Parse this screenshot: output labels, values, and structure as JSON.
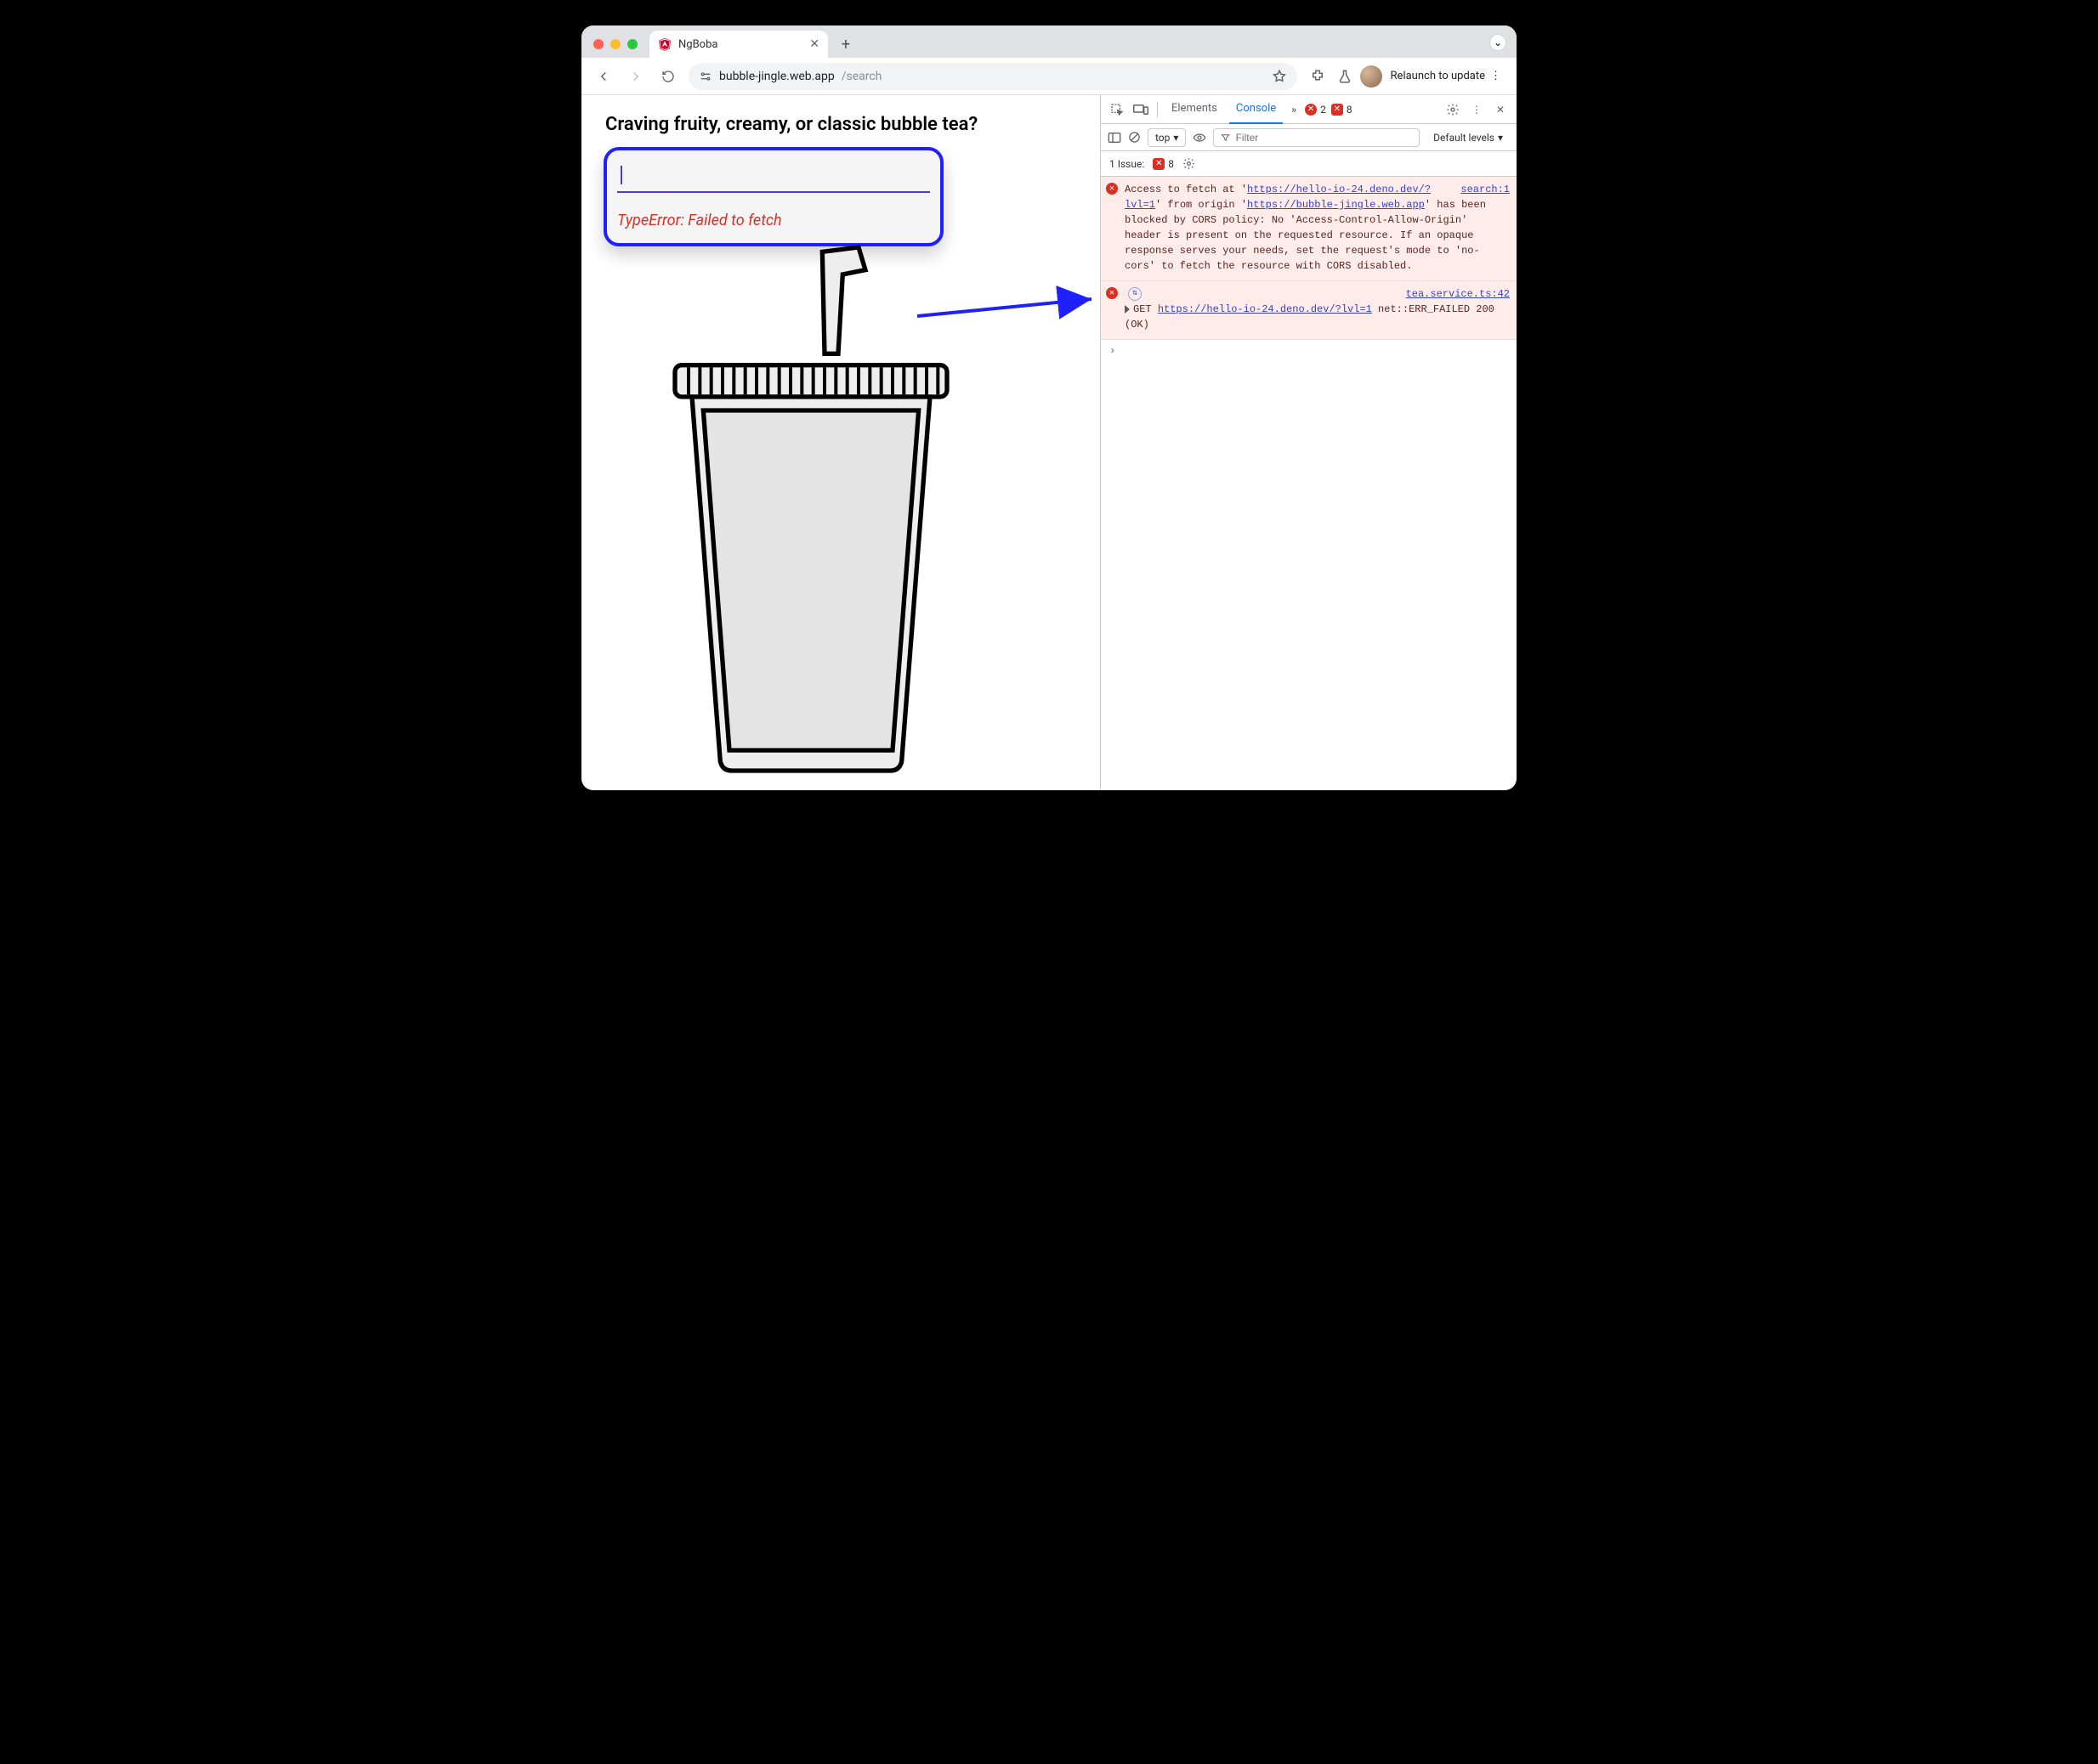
{
  "browser": {
    "tab_title": "NgBoba",
    "url_host": "bubble-jingle.web.app",
    "url_path": "/search",
    "relaunch_label": "Relaunch to update"
  },
  "page": {
    "heading": "Craving fruity, creamy, or classic bubble tea?",
    "error_text": "TypeError: Failed to fetch"
  },
  "devtools": {
    "tabs": {
      "elements": "Elements",
      "console": "Console"
    },
    "error_count": "2",
    "issue_count": "8",
    "toolbar": {
      "context": "top",
      "filter_placeholder": "Filter",
      "levels": "Default levels"
    },
    "issues": {
      "label": "1 Issue:",
      "count": "8"
    },
    "messages": [
      {
        "source": "search:1",
        "pre1": "Access to fetch at '",
        "url1": "https://hello-io-24.deno.dev/?lvl=1",
        "mid1": "' from origin '",
        "url2": "https://bubble-jingle.web.app",
        "post": "' has been blocked by CORS policy: No 'Access-Control-Allow-Origin' header is present on the requested resource. If an opaque response serves your needs, set the request's mode to 'no-cors' to fetch the resource with CORS disabled."
      },
      {
        "source": "tea.service.ts:42",
        "method": "GET",
        "url": "https://hello-io-24.deno.dev/?lvl=1",
        "tail": " net::ERR_FAILED 200 (OK)"
      }
    ]
  }
}
